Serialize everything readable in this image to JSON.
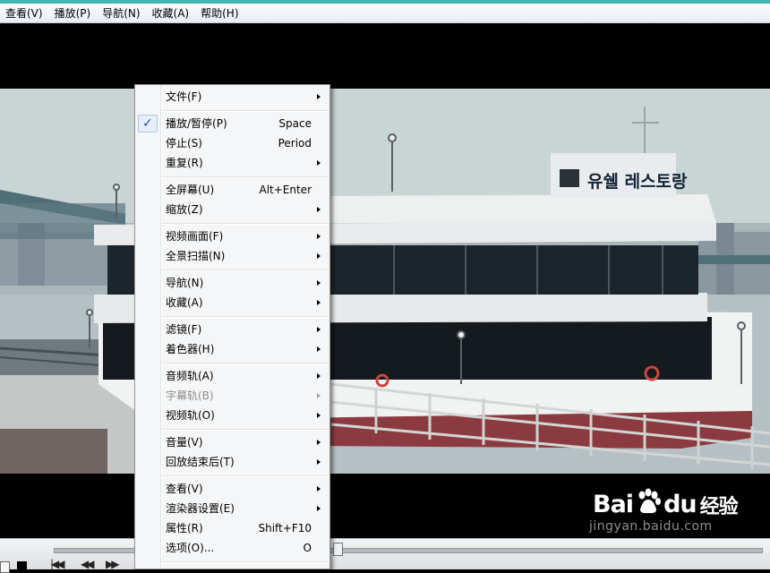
{
  "menubar": {
    "items": [
      "查看(V)",
      "播放(P)",
      "导航(N)",
      "收藏(A)",
      "帮助(H)"
    ]
  },
  "video": {
    "sign_text": "유쉘 레스토랑"
  },
  "watermark": {
    "logo_left": "Bai",
    "logo_right": "du",
    "logo_cn": "经验",
    "url": "jingyan.baidu.com"
  },
  "context_menu": {
    "items": [
      {
        "label": "文件(F)",
        "shortcut": "",
        "submenu": true
      },
      {
        "label": "播放/暂停(P)",
        "shortcut": "Space",
        "submenu": false,
        "checked": true
      },
      {
        "label": "停止(S)",
        "shortcut": "Period",
        "submenu": false
      },
      {
        "label": "重复(R)",
        "shortcut": "",
        "submenu": true
      },
      {
        "label": "全屏幕(U)",
        "shortcut": "Alt+Enter",
        "submenu": false
      },
      {
        "label": "缩放(Z)",
        "shortcut": "",
        "submenu": true
      },
      {
        "label": "视频画面(F)",
        "shortcut": "",
        "submenu": true
      },
      {
        "label": "全景扫描(N)",
        "shortcut": "",
        "submenu": true
      },
      {
        "label": "导航(N)",
        "shortcut": "",
        "submenu": true
      },
      {
        "label": "收藏(A)",
        "shortcut": "",
        "submenu": true
      },
      {
        "label": "滤镜(F)",
        "shortcut": "",
        "submenu": true
      },
      {
        "label": "着色器(H)",
        "shortcut": "",
        "submenu": true
      },
      {
        "label": "音频轨(A)",
        "shortcut": "",
        "submenu": true
      },
      {
        "label": "字幕轨(B)",
        "shortcut": "",
        "submenu": true,
        "disabled": true
      },
      {
        "label": "视频轨(O)",
        "shortcut": "",
        "submenu": true
      },
      {
        "label": "音量(V)",
        "shortcut": "",
        "submenu": true
      },
      {
        "label": "回放结束后(T)",
        "shortcut": "",
        "submenu": true
      },
      {
        "label": "查看(V)",
        "shortcut": "",
        "submenu": true
      },
      {
        "label": "渲染器设置(E)",
        "shortcut": "",
        "submenu": true
      },
      {
        "label": "属性(R)",
        "shortcut": "Shift+F10",
        "submenu": false
      },
      {
        "label": "选项(O)...",
        "shortcut": "O",
        "submenu": false
      }
    ],
    "check_glyph": "✓"
  },
  "colors": {
    "menu_bg": "#f5f6f7",
    "check_color": "#2d4fa1",
    "title_strip": "#3fb6b0"
  }
}
